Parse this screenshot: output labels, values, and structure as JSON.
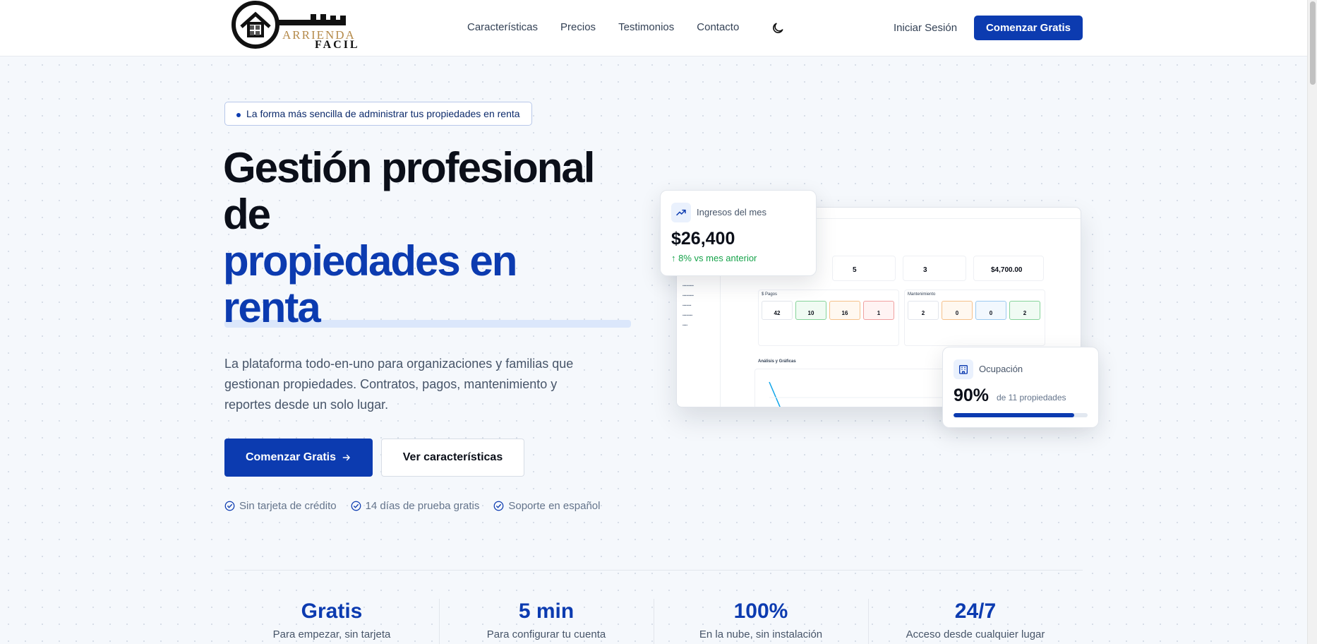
{
  "header": {
    "logo": {
      "line1": "ARRIENDA",
      "line2": "FACIL"
    },
    "nav": [
      "Características",
      "Precios",
      "Testimonios",
      "Contacto"
    ],
    "theme_icon": "moon-icon",
    "login": "Iniciar Sesión",
    "cta": "Comenzar Gratis"
  },
  "hero": {
    "pill": "La forma más sencilla de administrar tus propiedades en renta",
    "title_line1": "Gestión profesional",
    "title_line2": "de",
    "title_line3": "propiedades en",
    "title_line4": "renta",
    "lead": "La plataforma todo-en-uno para organizaciones y familias que gestionan propiedades. Contratos, pagos, mantenimiento y reportes desde un solo lugar.",
    "primary_button": "Comenzar Gratis",
    "secondary_button": "Ver características",
    "checks": [
      "Sin tarjeta de crédito",
      "14 días de prueba gratis",
      "Soporte en español"
    ]
  },
  "cards": {
    "income": {
      "label": "Ingresos del mes",
      "value": "$26,400",
      "change": "8% vs mes anterior",
      "icon": "trending-up-icon"
    },
    "occupancy": {
      "label": "Ocupación",
      "value": "90%",
      "sub": "de 11 propiedades",
      "icon": "building-icon",
      "progress": 0.9
    }
  },
  "dashboard": {
    "kpi_values": [
      "5",
      "3",
      "$4,700.00"
    ],
    "pagos_title": "$ Pagos",
    "pagos_values": [
      "42",
      "10",
      "16",
      "1"
    ],
    "mant_title": "Mantenimiento",
    "mant_values": [
      "2",
      "0",
      "0",
      "2"
    ],
    "analisis_title": "Análisis y Gráficas"
  },
  "stats": [
    {
      "value": "Gratis",
      "label": "Para empezar, sin tarjeta"
    },
    {
      "value": "5 min",
      "label": "Para configurar tu cuenta"
    },
    {
      "value": "100%",
      "label": "En la nube, sin instalación"
    },
    {
      "value": "24/7",
      "label": "Acceso desde cualquier lugar"
    }
  ],
  "colors": {
    "brand": "#0c3bb0",
    "positive": "#16a34a",
    "logo_gold": "#b58a4a"
  }
}
